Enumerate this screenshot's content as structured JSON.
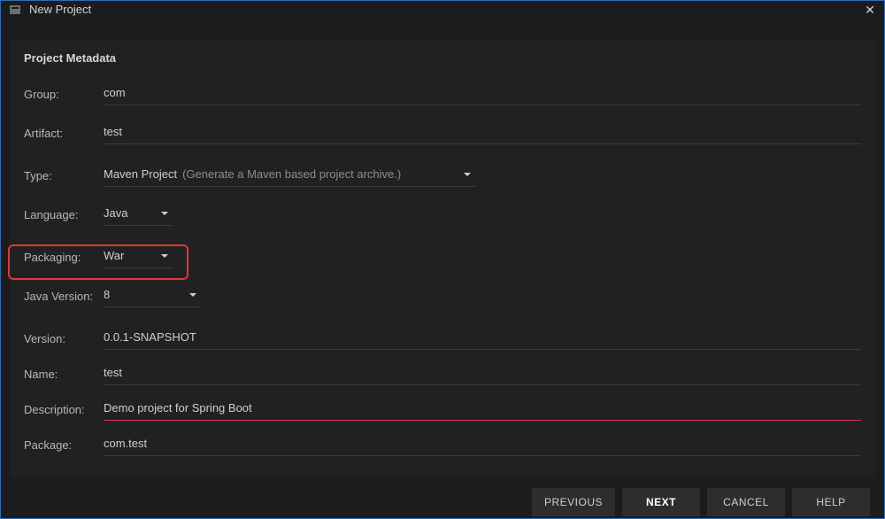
{
  "titlebar": {
    "title": "New Project"
  },
  "section_title": "Project Metadata",
  "form": {
    "group_label": "Group:",
    "group_value": "com",
    "artifact_label": "Artifact:",
    "artifact_value": "test",
    "type_label": "Type:",
    "type_value": "Maven Project",
    "type_hint": "(Generate a Maven based project archive.)",
    "language_label": "Language:",
    "language_value": "Java",
    "packaging_label": "Packaging:",
    "packaging_value": "War",
    "java_version_label": "Java Version:",
    "java_version_value": "8",
    "version_label": "Version:",
    "version_value": "0.0.1-SNAPSHOT",
    "name_label": "Name:",
    "name_value": "test",
    "description_label": "Description:",
    "description_value": "Demo project for Spring Boot",
    "package_label": "Package:",
    "package_value": "com.test"
  },
  "buttons": {
    "previous": "PREVIOUS",
    "next": "NEXT",
    "cancel": "CANCEL",
    "help": "HELP"
  }
}
